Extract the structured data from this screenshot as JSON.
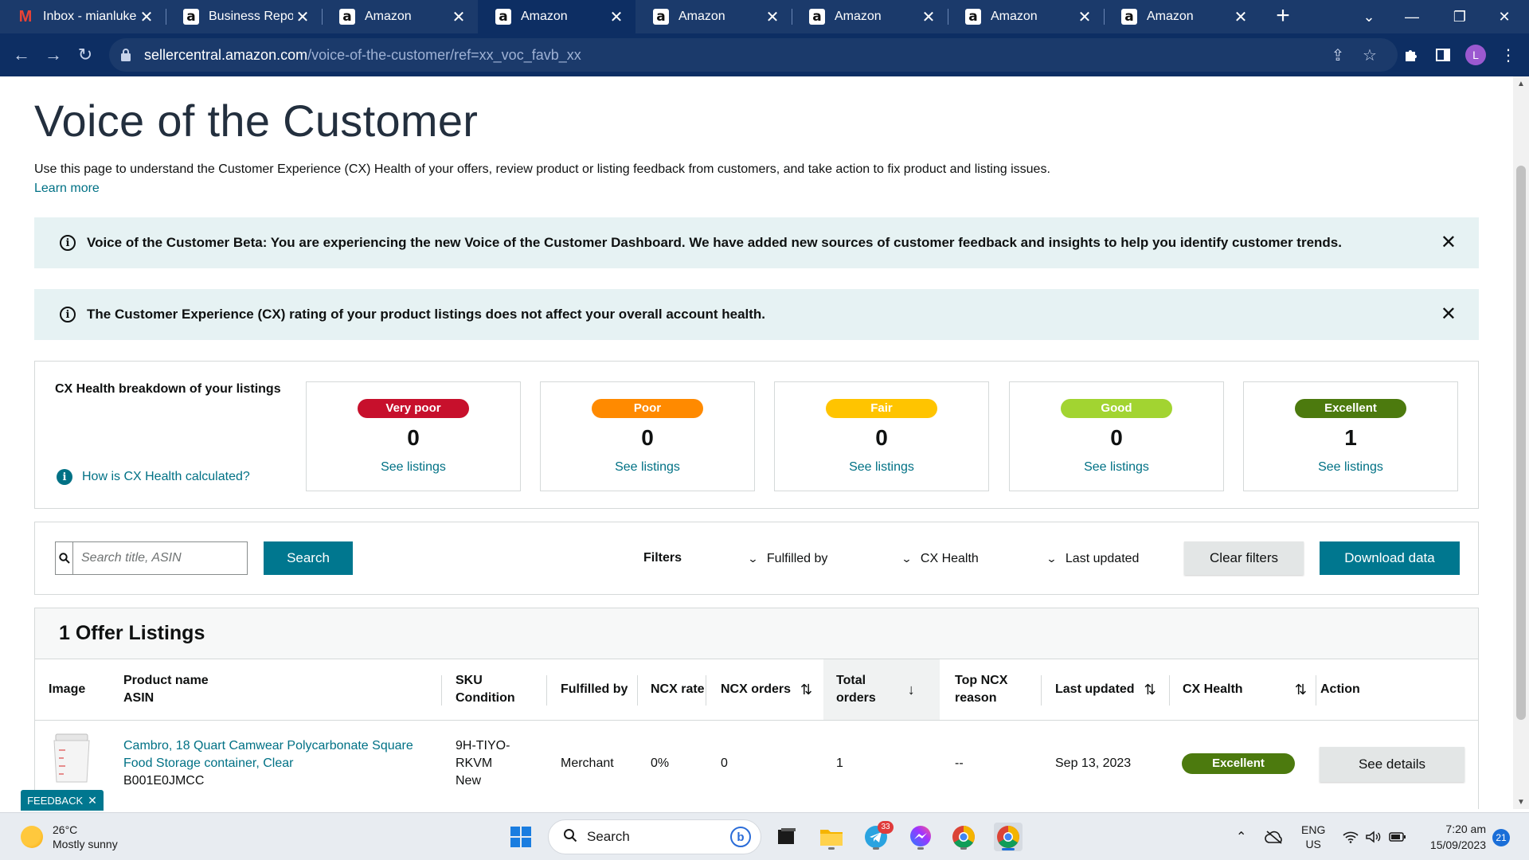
{
  "browser": {
    "tabs": [
      {
        "title": "Inbox - mianluke",
        "icon": "gmail-icon",
        "active": false
      },
      {
        "title": "Business Reports",
        "icon": "amazon-icon",
        "active": false
      },
      {
        "title": "Amazon",
        "icon": "amazon-icon",
        "active": false
      },
      {
        "title": "Amazon",
        "icon": "amazon-icon",
        "active": true
      },
      {
        "title": "Amazon",
        "icon": "amazon-icon",
        "active": false
      },
      {
        "title": "Amazon",
        "icon": "amazon-icon",
        "active": false
      },
      {
        "title": "Amazon",
        "icon": "amazon-icon",
        "active": false
      },
      {
        "title": "Amazon",
        "icon": "amazon-icon",
        "active": false
      }
    ],
    "url_host": "sellercentral.amazon.com",
    "url_path": "/voice-of-the-customer/ref=xx_voc_favb_xx",
    "profile_initial": "L"
  },
  "page": {
    "title": "Voice of the Customer",
    "intro": "Use this page to understand the Customer Experience (CX) Health of your offers, review product or listing feedback from customers, and take action to fix product and listing issues.",
    "learn_more": "Learn more",
    "banners": [
      "Voice of the Customer Beta: You are experiencing the new Voice of the Customer Dashboard. We have added new sources of customer feedback and insights to help you identify customer trends.",
      "The Customer Experience (CX) rating of your product listings does not affect your overall account health."
    ]
  },
  "cx_health": {
    "title": "CX Health breakdown of your listings",
    "how_link": "How is CX Health calculated?",
    "cards": [
      {
        "label": "Very poor",
        "count": "0",
        "link": "See listings",
        "color": "#c7102c",
        "text_color": "#ffffff"
      },
      {
        "label": "Poor",
        "count": "0",
        "link": "See listings",
        "color": "#ff8a00",
        "text_color": "#ffffff"
      },
      {
        "label": "Fair",
        "count": "0",
        "link": "See listings",
        "color": "#ffc400",
        "text_color": "#ffffff"
      },
      {
        "label": "Good",
        "count": "0",
        "link": "See listings",
        "color": "#a2d431",
        "text_color": "#ffffff"
      },
      {
        "label": "Excellent",
        "count": "1",
        "link": "See listings",
        "color": "#4c7a0e",
        "text_color": "#ffffff"
      }
    ]
  },
  "filters": {
    "search_placeholder": "Search title, ASIN",
    "search_button": "Search",
    "label": "Filters",
    "dropdowns": [
      "Fulfilled by",
      "CX Health",
      "Last updated"
    ],
    "clear": "Clear filters",
    "download": "Download data"
  },
  "listings": {
    "title": "1 Offer Listings",
    "headers": {
      "image": "Image",
      "product_name": "Product name",
      "asin": "ASIN",
      "sku": "SKU",
      "condition": "Condition",
      "fulfilled_by": "Fulfilled by",
      "ncx_rate": "NCX rate",
      "ncx_orders": "NCX orders",
      "total_orders_1": "Total",
      "total_orders_2": "orders",
      "top_ncx_1": "Top NCX",
      "top_ncx_2": "reason",
      "last_updated": "Last updated",
      "cx_health": "CX Health",
      "action": "Action"
    },
    "rows": [
      {
        "product_line1": "Cambro, 18 Quart Camwear Polycarbonate Square",
        "product_line2": "Food Storage container, Clear",
        "asin": "B001E0JMCC",
        "sku_line1": "9H-TIYO-",
        "sku_line2": "RKVM",
        "condition": "New",
        "fulfilled_by": "Merchant",
        "ncx_rate": "0%",
        "ncx_orders": "0",
        "total_orders": "1",
        "top_ncx": "--",
        "last_updated": "Sep 13, 2023",
        "cx_health": "Excellent",
        "action": "See details"
      }
    ]
  },
  "feedback": "FEEDBACK",
  "taskbar": {
    "temp": "26°C",
    "weather": "Mostly sunny",
    "search": "Search",
    "telegram_badge": "33",
    "lang1": "ENG",
    "lang2": "US",
    "time": "7:20 am",
    "date": "15/09/2023",
    "notifications": "21"
  }
}
